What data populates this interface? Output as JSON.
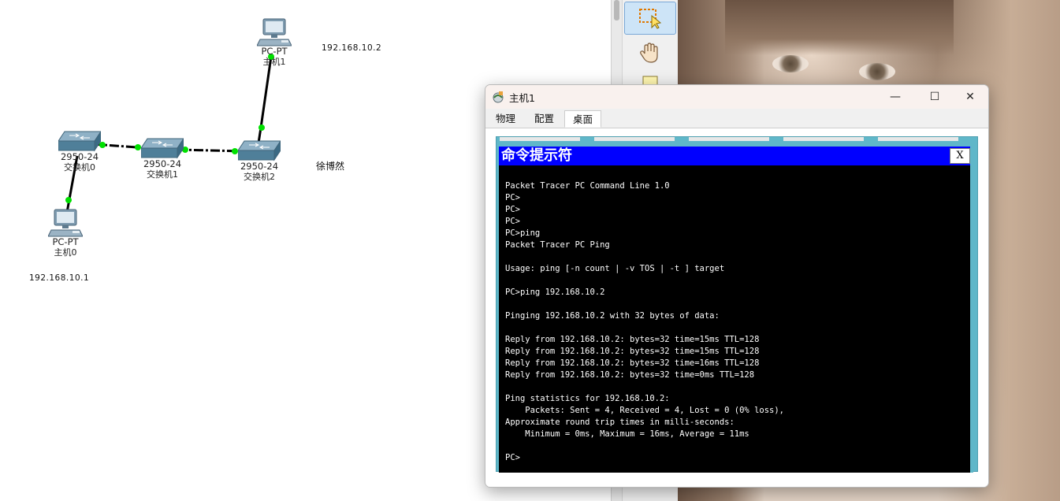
{
  "topology": {
    "devices": [
      {
        "id": "pc1",
        "model": "PC-PT",
        "name": "主机1"
      },
      {
        "id": "sw0",
        "model": "2950-24",
        "name": "交换机0"
      },
      {
        "id": "sw1",
        "model": "2950-24",
        "name": "交换机1"
      },
      {
        "id": "sw2",
        "model": "2950-24",
        "name": "交换机2"
      },
      {
        "id": "pc0",
        "model": "PC-PT",
        "name": "主机0"
      }
    ],
    "notes": {
      "pc1_ip": "192.168.10.2",
      "pc0_ip": "192.168.10.1",
      "author": "徐博然"
    },
    "link_color": "#000000",
    "port_up_color": "#00e000"
  },
  "palette": {
    "tools": [
      "select-tool",
      "hand-tool",
      "note-tool"
    ]
  },
  "window": {
    "title": "主机1",
    "tabs": [
      "物理",
      "配置",
      "桌面"
    ],
    "active_tab": "桌面",
    "controls": {
      "minimize": "—",
      "maximize": "☐",
      "close": "✕"
    }
  },
  "command_prompt": {
    "title": "命令提示符",
    "close_label": "X",
    "lines": [
      "Packet Tracer PC Command Line 1.0",
      "PC>",
      "PC>",
      "PC>",
      "PC>ping",
      "Packet Tracer PC Ping",
      "",
      "Usage: ping [-n count | -v TOS | -t ] target",
      "",
      "PC>ping 192.168.10.2",
      "",
      "Pinging 192.168.10.2 with 32 bytes of data:",
      "",
      "Reply from 192.168.10.2: bytes=32 time=15ms TTL=128",
      "Reply from 192.168.10.2: bytes=32 time=15ms TTL=128",
      "Reply from 192.168.10.2: bytes=32 time=16ms TTL=128",
      "Reply from 192.168.10.2: bytes=32 time=0ms TTL=128",
      "",
      "Ping statistics for 192.168.10.2:",
      "    Packets: Sent = 4, Received = 4, Lost = 0 (0% loss),",
      "Approximate round trip times in milli-seconds:",
      "    Minimum = 0ms, Maximum = 16ms, Average = 11ms",
      "",
      "PC>"
    ]
  },
  "colors": {
    "cmd_title_bar": "#0000ff",
    "cmd_background": "#000000",
    "desktop_frame": "#5fb7c9"
  }
}
